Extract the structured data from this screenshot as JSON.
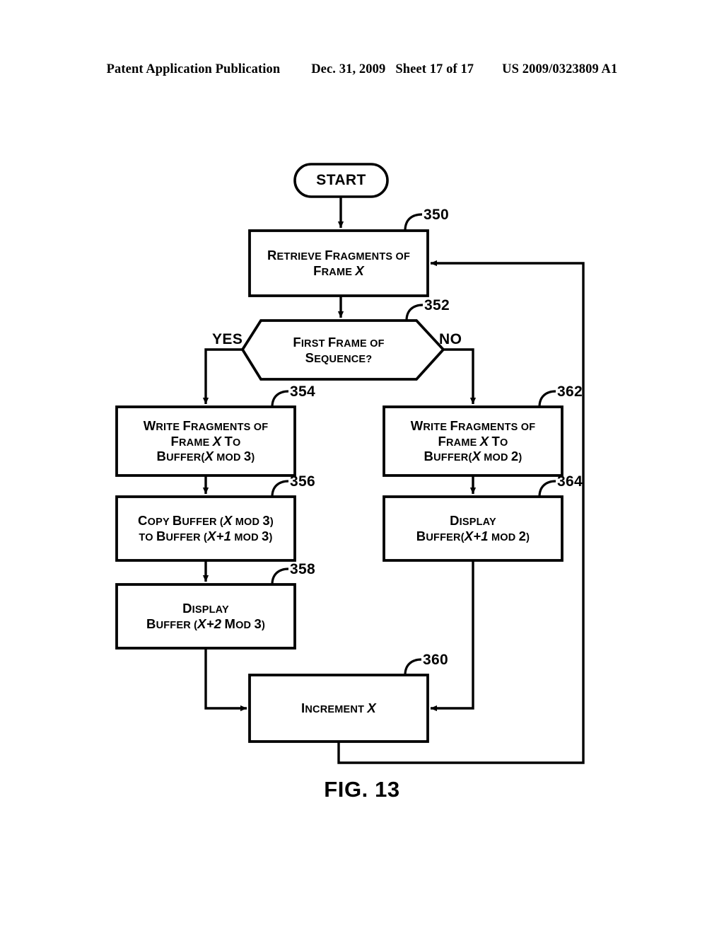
{
  "header": {
    "publication": "Patent Application Publication",
    "date": "Dec. 31, 2009",
    "sheet": "Sheet 17 of 17",
    "patent_number": "US 2009/0323809 A1"
  },
  "figure": {
    "caption": "FIG. 13",
    "line_color": "#000000",
    "background": "#ffffff"
  },
  "nodes": {
    "start": {
      "label": "START"
    },
    "n350": {
      "ref": "350",
      "line1": "Retrieve Fragments of",
      "line2_pre": "Frame ",
      "line2_var": "X"
    },
    "n352": {
      "ref": "352",
      "line1": "First Frame of",
      "line2": "Sequence?",
      "yes": "YES",
      "no": "NO"
    },
    "n354": {
      "ref": "354",
      "line1": "Write Fragments of",
      "line2_pre": "Frame ",
      "line2_var": "X",
      "line2_post": " To",
      "line3_pre": "Buffer(",
      "line3_var": "X",
      "line3_post": " mod 3)"
    },
    "n356": {
      "ref": "356",
      "line1_pre": "Copy Buffer (",
      "line1_var": "X",
      "line1_post": " mod 3)",
      "line2_pre": "to Buffer (",
      "line2_var": "X+1",
      "line2_post": " mod 3)"
    },
    "n358": {
      "ref": "358",
      "line1": "Display",
      "line2_pre": "Buffer (",
      "line2_var": "X+2",
      "line2_post": " Mod 3)"
    },
    "n360": {
      "ref": "360",
      "line1_pre": "Increment ",
      "line1_var": "X"
    },
    "n362": {
      "ref": "362",
      "line1": "Write Fragments of",
      "line2_pre": "Frame ",
      "line2_var": "X",
      "line2_post": " To",
      "line3_pre": "Buffer(",
      "line3_var": "X",
      "line3_post": " mod 2)"
    },
    "n364": {
      "ref": "364",
      "line1": "Display",
      "line2_pre": "Buffer(",
      "line2_var": "X+1",
      "line2_post": " mod 2)"
    }
  }
}
